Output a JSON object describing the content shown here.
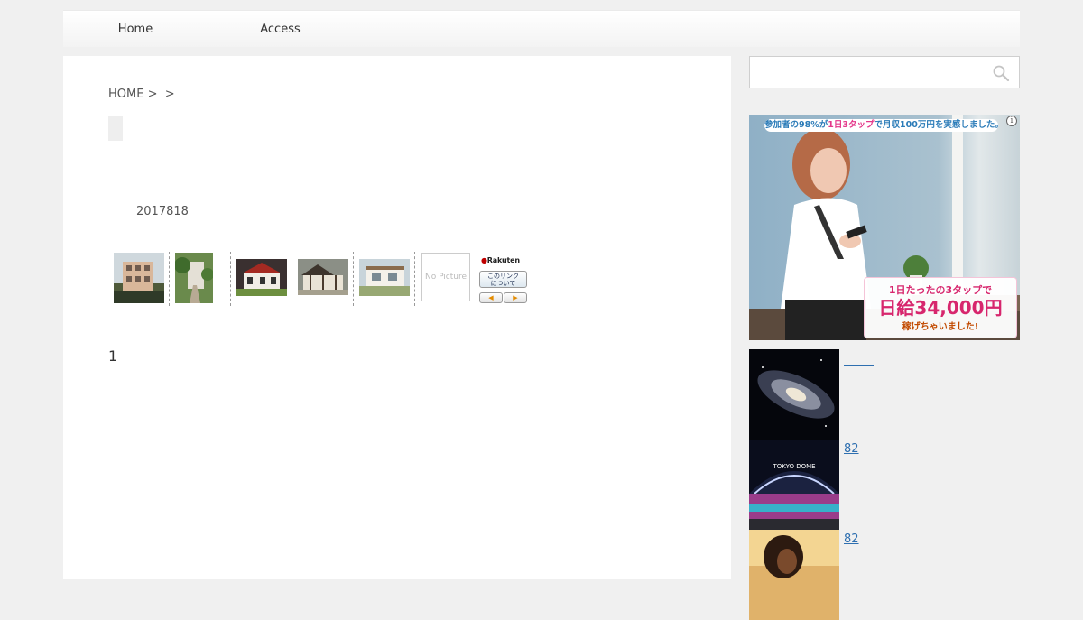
{
  "nav": {
    "items": [
      {
        "label": "Home"
      },
      {
        "label": "Access"
      }
    ]
  },
  "breadcrumb": {
    "home": "HOME",
    "separator1": ">",
    "separator2": ">"
  },
  "post": {
    "date": "2017818",
    "number": "1"
  },
  "rakuten": {
    "nopic_text": "No Picture",
    "logo": "Rakuten",
    "link_label": "このリンクについて",
    "prev_arrow": "◀",
    "next_arrow": "▶"
  },
  "sidebar": {
    "search": {
      "placeholder": "",
      "value": ""
    },
    "ad": {
      "top_text_pre": "参加者の98%が",
      "top_text_pink": "1日3タップ",
      "top_text_post": "で月収100万円を実感しました。",
      "badge_line1": "1日たったの3タップで",
      "badge_line2": "日給34,000円",
      "badge_line3": "稼げちゃいました!",
      "info_icon": "i"
    },
    "posts": [
      {
        "title": "",
        "thumb": "galaxy"
      },
      {
        "title": "82",
        "thumb": "tokyo-dome",
        "thumb_caption": "TOKYO DOME"
      },
      {
        "title": "82",
        "thumb": "sunset-portrait"
      }
    ]
  },
  "colors": {
    "page_bg": "#f0f0f0",
    "link": "#2e6fb0",
    "ad_pink": "#d7266d"
  }
}
